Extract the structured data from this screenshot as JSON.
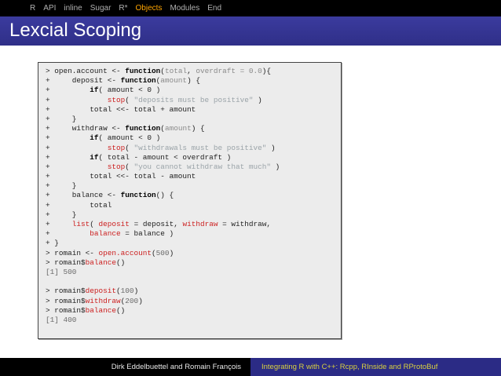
{
  "nav": {
    "items": [
      {
        "label": "R"
      },
      {
        "label": "API"
      },
      {
        "label": "inline"
      },
      {
        "label": "Sugar"
      },
      {
        "label": "R*"
      },
      {
        "label": "Objects",
        "active": true
      },
      {
        "label": "Modules"
      },
      {
        "label": "End"
      }
    ]
  },
  "title": "Lexcial Scoping",
  "code": {
    "lines": [
      [
        {
          "t": "> open.account <- "
        },
        {
          "t": "function",
          "c": "kw"
        },
        {
          "t": "("
        },
        {
          "t": "total",
          "c": "var"
        },
        {
          "t": ", "
        },
        {
          "t": "overdraft = 0.0",
          "c": "var"
        },
        {
          "t": "){"
        }
      ],
      [
        {
          "t": "+     deposit <- "
        },
        {
          "t": "function",
          "c": "kw"
        },
        {
          "t": "("
        },
        {
          "t": "amount",
          "c": "var"
        },
        {
          "t": ") {"
        }
      ],
      [
        {
          "t": "+         "
        },
        {
          "t": "if",
          "c": "kw"
        },
        {
          "t": "( amount < 0 )"
        }
      ],
      [
        {
          "t": "+             "
        },
        {
          "t": "stop",
          "c": "red"
        },
        {
          "t": "( "
        },
        {
          "t": "\"deposits must be positive\"",
          "c": "str"
        },
        {
          "t": " )"
        }
      ],
      [
        {
          "t": "+         total <<- total + amount"
        }
      ],
      [
        {
          "t": "+     }"
        }
      ],
      [
        {
          "t": "+     withdraw <- "
        },
        {
          "t": "function",
          "c": "kw"
        },
        {
          "t": "("
        },
        {
          "t": "amount",
          "c": "var"
        },
        {
          "t": ") {"
        }
      ],
      [
        {
          "t": "+         "
        },
        {
          "t": "if",
          "c": "kw"
        },
        {
          "t": "( amount < 0 )"
        }
      ],
      [
        {
          "t": "+             "
        },
        {
          "t": "stop",
          "c": "red"
        },
        {
          "t": "( "
        },
        {
          "t": "\"withdrawals must be positive\"",
          "c": "str"
        },
        {
          "t": " )"
        }
      ],
      [
        {
          "t": "+         "
        },
        {
          "t": "if",
          "c": "kw"
        },
        {
          "t": "( total - amount < overdraft )"
        }
      ],
      [
        {
          "t": "+             "
        },
        {
          "t": "stop",
          "c": "red"
        },
        {
          "t": "( "
        },
        {
          "t": "\"you cannot withdraw that much\"",
          "c": "str"
        },
        {
          "t": " )"
        }
      ],
      [
        {
          "t": "+         total <<- total - amount"
        }
      ],
      [
        {
          "t": "+     }"
        }
      ],
      [
        {
          "t": "+     balance <- "
        },
        {
          "t": "function",
          "c": "kw"
        },
        {
          "t": "() {"
        }
      ],
      [
        {
          "t": "+         total"
        }
      ],
      [
        {
          "t": "+     }"
        }
      ],
      [
        {
          "t": "+     "
        },
        {
          "t": "list",
          "c": "red"
        },
        {
          "t": "( "
        },
        {
          "t": "deposit",
          "c": "red"
        },
        {
          "t": " = deposit, "
        },
        {
          "t": "withdraw",
          "c": "red"
        },
        {
          "t": " = withdraw,"
        }
      ],
      [
        {
          "t": "+         "
        },
        {
          "t": "balance",
          "c": "red"
        },
        {
          "t": " = balance )"
        }
      ],
      [
        {
          "t": "+ }"
        }
      ],
      [
        {
          "t": "> romain <- "
        },
        {
          "t": "open.account",
          "c": "red"
        },
        {
          "t": "("
        },
        {
          "t": "500",
          "c": "num"
        },
        {
          "t": ")"
        }
      ],
      [
        {
          "t": "> romain$"
        },
        {
          "t": "balance",
          "c": "red"
        },
        {
          "t": "()"
        }
      ],
      [
        {
          "t": "[1] 500",
          "c": "num"
        }
      ],
      [],
      [
        {
          "t": "> romain$"
        },
        {
          "t": "deposit",
          "c": "red"
        },
        {
          "t": "("
        },
        {
          "t": "100",
          "c": "num"
        },
        {
          "t": ")"
        }
      ],
      [
        {
          "t": "> romain$"
        },
        {
          "t": "withdraw",
          "c": "red"
        },
        {
          "t": "("
        },
        {
          "t": "200",
          "c": "num"
        },
        {
          "t": ")"
        }
      ],
      [
        {
          "t": "> romain$"
        },
        {
          "t": "balance",
          "c": "red"
        },
        {
          "t": "()"
        }
      ],
      [
        {
          "t": "[1] 400",
          "c": "num"
        }
      ]
    ]
  },
  "footer": {
    "authors": "Dirk Eddelbuettel and Romain François",
    "talk_title": "Integrating R with C++: Rcpp, RInside and RProtoBuf"
  }
}
